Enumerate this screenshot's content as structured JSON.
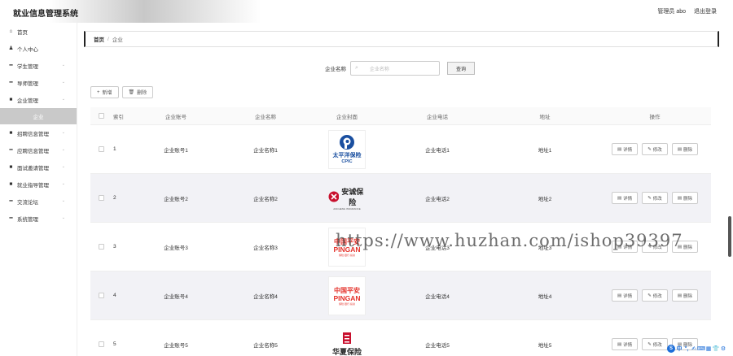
{
  "header": {
    "title": "就业信息管理系统",
    "user": "管理员 abo",
    "logout": "退出登录"
  },
  "sidebar": {
    "items": [
      {
        "label": "首页",
        "icon": "home-icon",
        "glyph": "⌂"
      },
      {
        "label": "个人中心",
        "icon": "user-icon",
        "glyph": "♟"
      },
      {
        "label": "学生管理",
        "icon": "grid-icon",
        "glyph": "▪▪"
      },
      {
        "label": "导师管理",
        "icon": "grid-icon",
        "glyph": "▪▪"
      },
      {
        "label": "企业管理",
        "icon": "lock-icon",
        "glyph": "■"
      }
    ],
    "active_sub": "企业",
    "items2": [
      {
        "label": "招聘信息管理",
        "icon": "message-icon",
        "glyph": "■"
      },
      {
        "label": "应聘信息管理",
        "icon": "grid-icon",
        "glyph": "▪▪"
      },
      {
        "label": "面试邀请管理",
        "icon": "message-icon",
        "glyph": "■"
      },
      {
        "label": "就业指导管理",
        "icon": "message-icon",
        "glyph": "■"
      },
      {
        "label": "交流论坛",
        "icon": "grid-icon",
        "glyph": "▪▪"
      },
      {
        "label": "系统管理",
        "icon": "grid-icon",
        "glyph": "▪▪"
      }
    ]
  },
  "breadcrumb": {
    "home": "首页",
    "sep": "/",
    "current": "企业"
  },
  "search": {
    "label": "企业名称",
    "placeholder": "企业名称",
    "button": "查询"
  },
  "toolbar": {
    "add": "新增",
    "delete": "删除"
  },
  "table": {
    "headers": {
      "index": "索引",
      "account": "企业账号",
      "name": "企业名称",
      "cover": "企业封面",
      "phone": "企业电话",
      "address": "地址",
      "actions": "操作"
    },
    "actions": {
      "detail": "详情",
      "edit": "修改",
      "delete": "删除"
    },
    "rows": [
      {
        "index": "1",
        "account": "企业账号1",
        "name": "企业名称1",
        "phone": "企业电话1",
        "address": "地址1",
        "logo": "cpic"
      },
      {
        "index": "2",
        "account": "企业账号2",
        "name": "企业名称2",
        "phone": "企业电话2",
        "address": "地址2",
        "logo": "anxin"
      },
      {
        "index": "3",
        "account": "企业账号3",
        "name": "企业名称3",
        "phone": "企业电话3",
        "address": "地址3",
        "logo": "pingan"
      },
      {
        "index": "4",
        "account": "企业账号4",
        "name": "企业名称4",
        "phone": "企业电话4",
        "address": "地址4",
        "logo": "pingan"
      },
      {
        "index": "5",
        "account": "企业账号5",
        "name": "企业名称5",
        "phone": "企业电话5",
        "address": "地址5",
        "logo": "huaxia"
      }
    ]
  },
  "logos": {
    "cpic": {
      "line1": "太平洋保险",
      "line2": "CPIC",
      "color": "#1a4fa0"
    },
    "anxin": {
      "line1": "安诚保险",
      "line2": "ANCHENG INSURANCE",
      "color": "#c8102e"
    },
    "pingan": {
      "line1": "中国平安",
      "line2": "PINGAN",
      "line3": "保险·银行·投资",
      "color": "#e4322b"
    },
    "huaxia": {
      "line1": "华夏保险",
      "color": "#c8102e"
    }
  },
  "watermark": "https://www.huzhan.com/ishop39397",
  "ime": {
    "logo": "S",
    "chars": [
      "中",
      "°,",
      "✍",
      "⌨",
      "▦",
      "👕",
      "⚙"
    ]
  },
  "colors": {
    "active_sub_bg": "#c9c9c9",
    "alt_row": "#f2f2f6"
  }
}
